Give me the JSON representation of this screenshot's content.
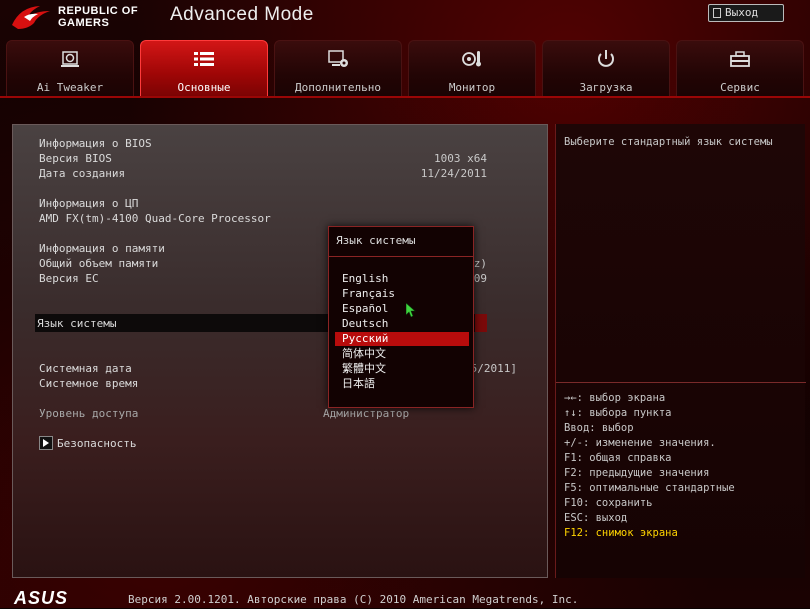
{
  "header": {
    "brand_line1": "REPUBLIC OF",
    "brand_line2": "GAMERS",
    "title": "Advanced Mode",
    "exit_label": "Выход"
  },
  "tabs": [
    {
      "label": "Ai Tweaker",
      "icon": "cpu-fan-icon",
      "active": false
    },
    {
      "label": "Основные",
      "icon": "list-icon",
      "active": true
    },
    {
      "label": "Дополнительно",
      "icon": "settings-screen-icon",
      "active": false
    },
    {
      "label": "Монитор",
      "icon": "thermometer-fan-icon",
      "active": false
    },
    {
      "label": "Загрузка",
      "icon": "power-icon",
      "active": false
    },
    {
      "label": "Сервис",
      "icon": "toolbox-icon",
      "active": false
    }
  ],
  "main": {
    "bios_info_heading": "Информация о BIOS",
    "bios_version_label": "Версия BIOS",
    "bios_version_value": "1003 x64",
    "build_date_label": "Дата создания",
    "build_date_value": "11/24/2011",
    "cpu_info_heading": "Информация о ЦП",
    "cpu_model": "AMD FX(tm)-4100 Quad-Core Processor",
    "mem_info_heading": "Информация о памяти",
    "total_mem_label": "Общий объем памяти",
    "total_mem_value_partial": "z)",
    "ec_version_label": "Версия EC",
    "ec_version_value_partial": "09",
    "system_language_label": "Язык системы",
    "system_date_label": "Системная дата",
    "system_date_value_partial": "5/2011]",
    "system_time_label": "Системное время",
    "access_level_label": "Уровень доступа",
    "access_level_value": "Администратор",
    "security_label": "Безопасность"
  },
  "popup": {
    "title": "Язык системы",
    "options": [
      "English",
      "Français",
      "Español",
      "Deutsch",
      "Русский",
      "简体中文",
      "繁體中文",
      "日本語"
    ],
    "selected_index": 4
  },
  "help": {
    "description": "Выберите стандартный язык системы",
    "keys": [
      "→←: выбор экрана",
      "↑↓: выбора пункта",
      "Ввод: выбор",
      "+/-: изменение значения.",
      "F1: общая справка",
      "F2: предыдущие значения",
      "F5: оптимальные стандартные",
      "F10: сохранить",
      "ESC: выход",
      "F12: снимок экрана"
    ]
  },
  "footer": {
    "logo": "ASUS",
    "text": "Версия 2.00.1201. Авторские права (C) 2010 American Megatrends, Inc."
  },
  "colors": {
    "accent_red": "#b80c0c",
    "tab_active": "#d31616",
    "highlight_key": "#ffd400"
  }
}
